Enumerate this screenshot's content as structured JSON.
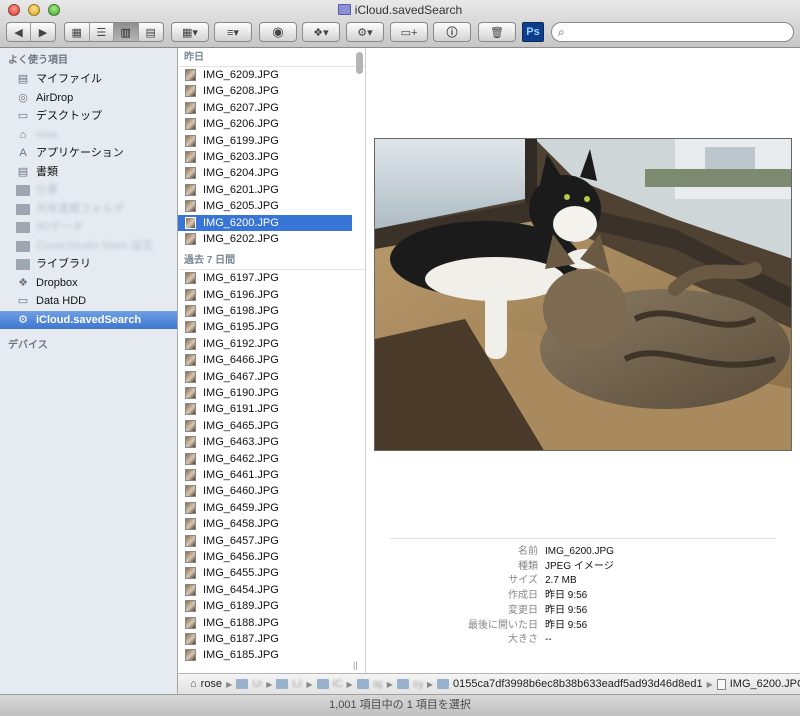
{
  "window": {
    "title": "iCloud.savedSearch"
  },
  "toolbar": {
    "back_icon": "chevron-left-icon",
    "forward_icon": "chevron-right-icon",
    "view_modes": [
      "icon-view",
      "list-view",
      "column-view",
      "cover-flow-view"
    ],
    "active_view": "column-view",
    "quick_look_icon": "eye-icon",
    "share_icon": "dropbox-icon",
    "action_icon": "gear-icon",
    "new_folder_icon": "folder-add-icon",
    "info_icon": "info-icon",
    "trash_icon": "trash-icon",
    "ps_label": "Ps",
    "search": {
      "value": "",
      "placeholder": ""
    }
  },
  "sidebar": {
    "favorites_heading": "よく使う項目",
    "items": [
      {
        "label": "マイファイル",
        "icon": "all-my-files-icon",
        "glyph": "▤"
      },
      {
        "label": "AirDrop",
        "icon": "airdrop-icon",
        "glyph": "◎"
      },
      {
        "label": "デスクトップ",
        "icon": "desktop-icon",
        "glyph": "▭"
      },
      {
        "label": "rose",
        "icon": "home-icon",
        "glyph": "⌂",
        "blurred": true
      },
      {
        "label": "アプリケーション",
        "icon": "applications-icon",
        "glyph": "A"
      },
      {
        "label": "書類",
        "icon": "documents-icon",
        "glyph": "▤"
      },
      {
        "label": "仕事",
        "icon": "folder-icon",
        "glyph": "",
        "blurred": true
      },
      {
        "label": "共有書類フォルダ",
        "icon": "folder-icon",
        "glyph": "",
        "blurred": true
      },
      {
        "label": "3Dデータ",
        "icon": "folder-icon",
        "glyph": "",
        "blurred": true
      },
      {
        "label": "ComicStudio Startr 設定",
        "icon": "folder-icon",
        "glyph": "",
        "blurred": true
      },
      {
        "label": "ライブラリ",
        "icon": "folder-icon",
        "glyph": ""
      },
      {
        "label": "Dropbox",
        "icon": "dropbox-icon",
        "glyph": "❖"
      },
      {
        "label": "Data HDD",
        "icon": "drive-icon",
        "glyph": "▭"
      },
      {
        "label": "iCloud.savedSearch",
        "icon": "gear-icon",
        "glyph": "⚙",
        "selected": true
      }
    ],
    "devices_heading": "デバイス"
  },
  "file_list": {
    "groups": [
      {
        "title": "昨日",
        "files": [
          "IMG_6209.JPG",
          "IMG_6208.JPG",
          "IMG_6207.JPG",
          "IMG_6206.JPG",
          "IMG_6199.JPG",
          "IMG_6203.JPG",
          "IMG_6204.JPG",
          "IMG_6201.JPG",
          "IMG_6205.JPG",
          "IMG_6200.JPG",
          "IMG_6202.JPG"
        ]
      },
      {
        "title": "過去 7 日間",
        "files": [
          "IMG_6197.JPG",
          "IMG_6196.JPG",
          "IMG_6198.JPG",
          "IMG_6195.JPG",
          "IMG_6192.JPG",
          "IMG_6466.JPG",
          "IMG_6467.JPG",
          "IMG_6190.JPG",
          "IMG_6191.JPG",
          "IMG_6465.JPG",
          "IMG_6463.JPG",
          "IMG_6462.JPG",
          "IMG_6461.JPG",
          "IMG_6460.JPG",
          "IMG_6459.JPG",
          "IMG_6458.JPG",
          "IMG_6457.JPG",
          "IMG_6456.JPG",
          "IMG_6455.JPG",
          "IMG_6454.JPG",
          "IMG_6189.JPG",
          "IMG_6188.JPG",
          "IMG_6187.JPG",
          "IMG_6185.JPG"
        ]
      }
    ],
    "selected_file": "IMG_6200.JPG"
  },
  "preview": {
    "image_description": "two-cats-on-windowsill-photo",
    "info": [
      {
        "key": "名前",
        "value": "IMG_6200.JPG"
      },
      {
        "key": "種類",
        "value": "JPEG イメージ"
      },
      {
        "key": "サイズ",
        "value": "2.7 MB"
      },
      {
        "key": "作成日",
        "value": "昨日 9:56"
      },
      {
        "key": "変更日",
        "value": "昨日 9:56"
      },
      {
        "key": "最後に開いた日",
        "value": "昨日 9:56"
      },
      {
        "key": "大きさ",
        "value": "--"
      }
    ]
  },
  "path_bar": [
    {
      "label": "rose",
      "type": "home",
      "blurred": false
    },
    {
      "label": "Users",
      "type": "folder",
      "blurred": true
    },
    {
      "label": "Library",
      "type": "folder",
      "blurred": true
    },
    {
      "label": "iCloud",
      "type": "folder",
      "blurred": true
    },
    {
      "label": "app",
      "type": "folder",
      "blurred": true
    },
    {
      "label": "sync",
      "type": "folder",
      "blurred": true
    },
    {
      "label": "0155ca7df3998b6ec8b38b633eadf5ad93d46d8ed1",
      "type": "folder",
      "blurred": false
    },
    {
      "label": "IMG_6200.JPG",
      "type": "file",
      "blurred": false
    }
  ],
  "status_bar": {
    "text": "1,001 項目中の 1 項目を選択"
  }
}
